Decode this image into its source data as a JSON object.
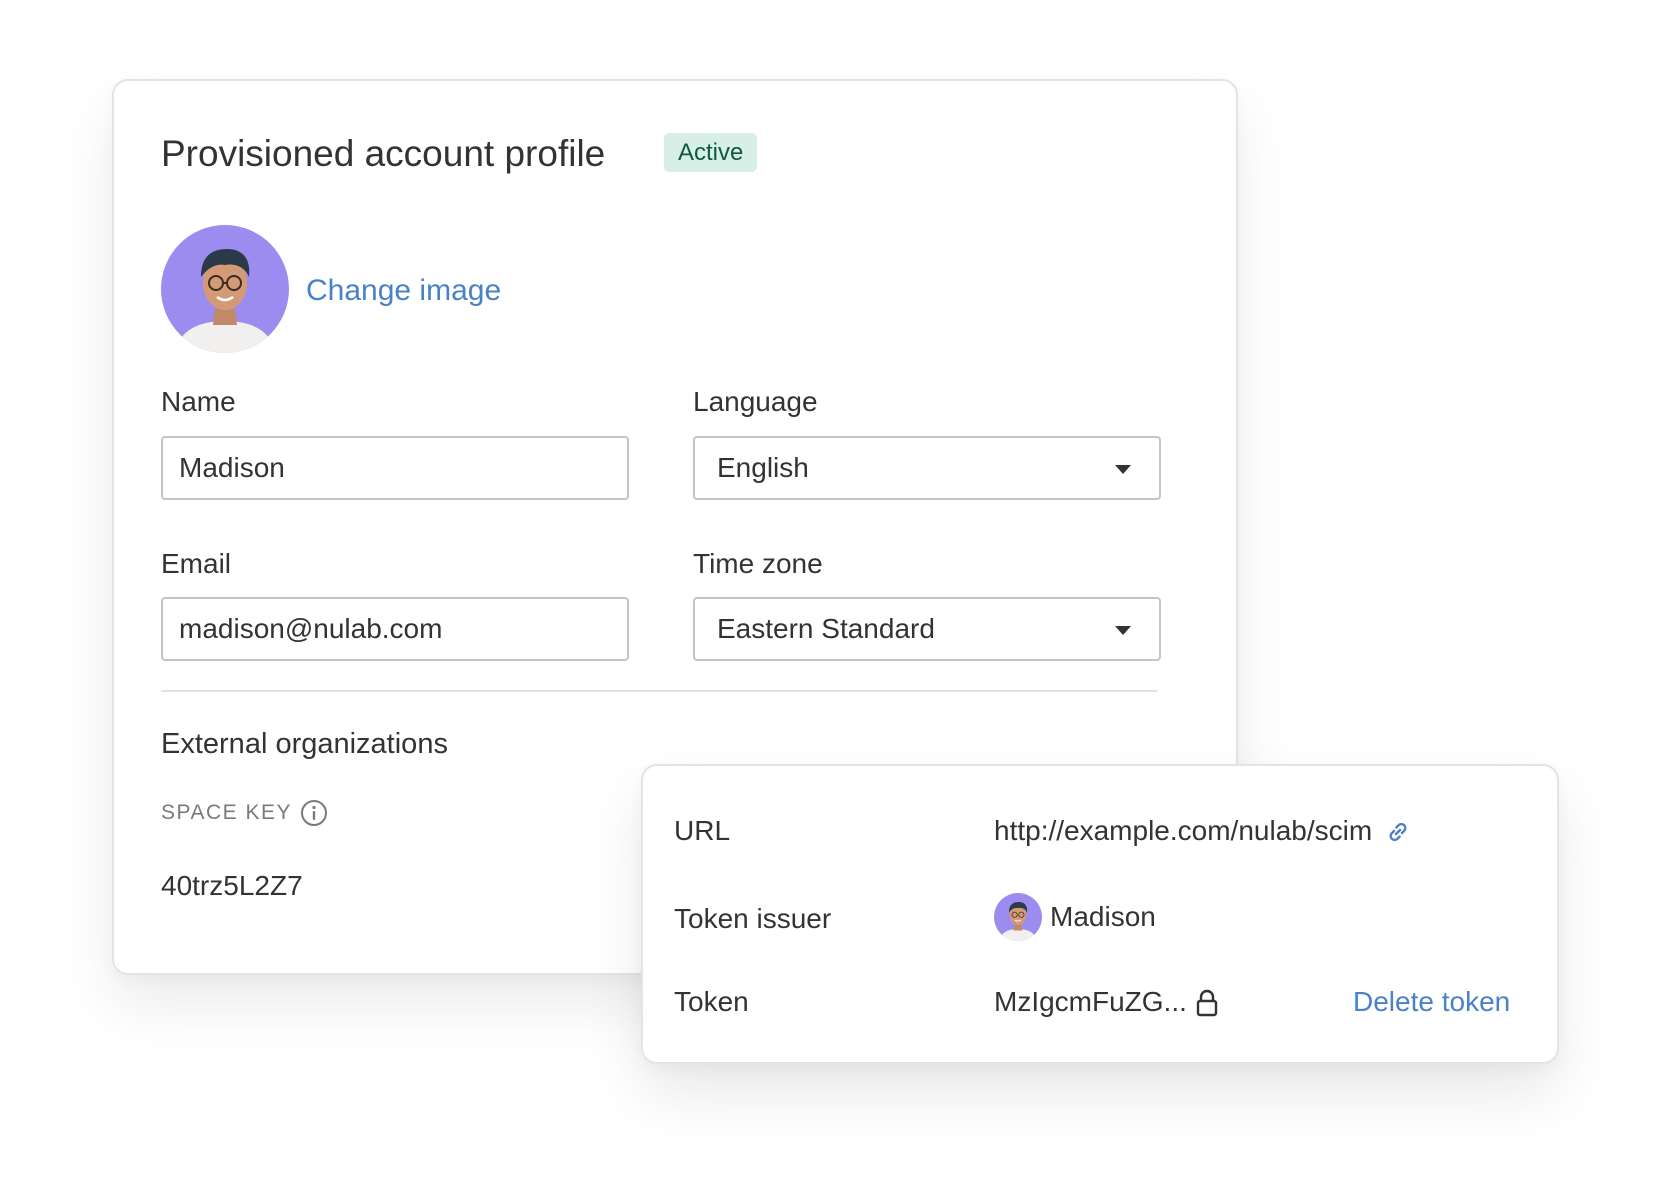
{
  "profile": {
    "title": "Provisioned account profile",
    "status_badge": "Active",
    "change_image_label": "Change image",
    "name_label": "Name",
    "name_value": "Madison",
    "language_label": "Language",
    "language_value": "English",
    "email_label": "Email",
    "email_value": "madison@nulab.com",
    "timezone_label": "Time zone",
    "timezone_value": "Eastern Standard"
  },
  "external_orgs": {
    "section_title": "External organizations",
    "space_key_label": "SPACE KEY",
    "space_key_value": "40trz5L2Z7"
  },
  "token_panel": {
    "url_label": "URL",
    "url_value": "http://example.com/nulab/scim",
    "issuer_label": "Token issuer",
    "issuer_value": "Madison",
    "token_label": "Token",
    "token_value": "MzIgcmFuZG...",
    "delete_label": "Delete token"
  },
  "icons": {
    "avatar": "user-photo",
    "info": "info-circle-icon",
    "link": "chain-link-icon",
    "lock": "lock-icon",
    "dropdown": "caret-down-icon"
  },
  "colors": {
    "accent_link": "#4a82c7",
    "badge_bg": "#d7efe7",
    "badge_text": "#0e5a40",
    "avatar_bg": "#9c8cf0"
  }
}
